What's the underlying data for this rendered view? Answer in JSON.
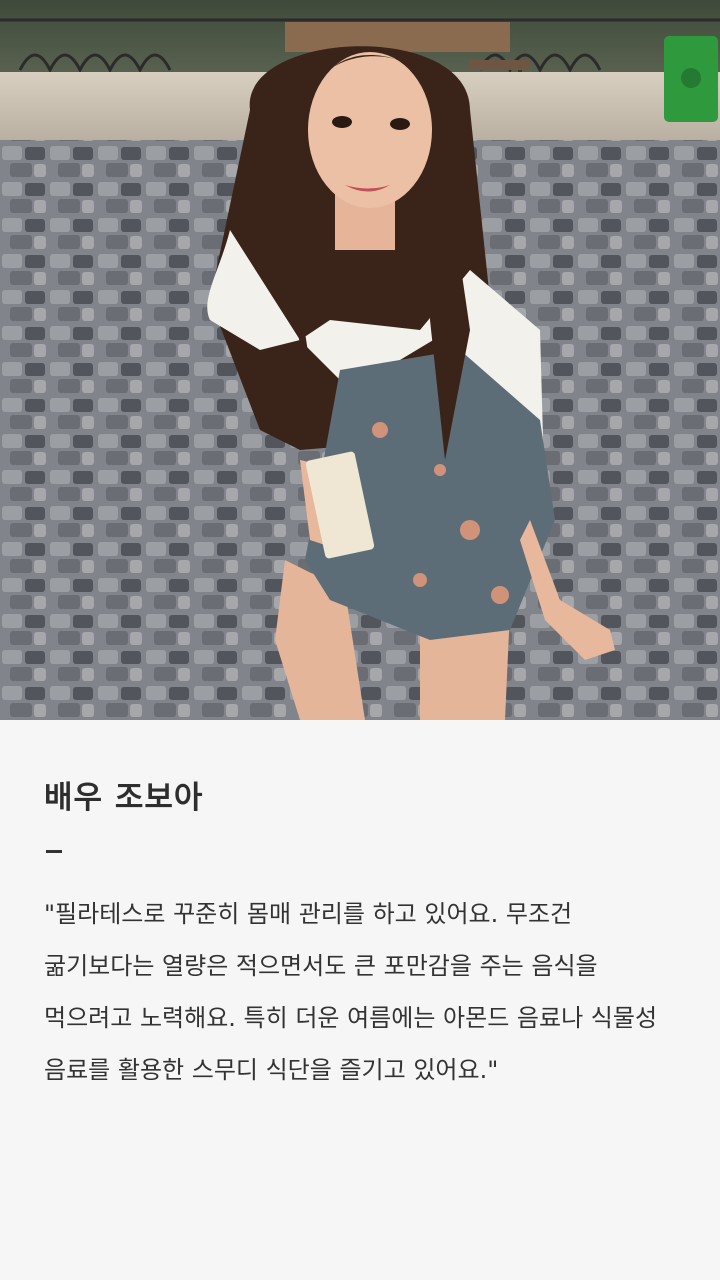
{
  "photo": {
    "description_icon": "portrait-photo",
    "colors": {
      "cobblestone_light": "#a3a6ab",
      "cobblestone_dark": "#45484e",
      "blouse": "#f3f1ec",
      "dress": "#5d6d78",
      "hair": "#3a241a",
      "skin": "#e8b89c"
    }
  },
  "article": {
    "name": "배우 조보아",
    "quote": "\"필라테스로 꾸준히 몸매 관리를 하고 있어요. 무조건 굶기보다는 열량은 적으면서도 큰 포만감을 주는 음식을 먹으려고 노력해요. 특히 더운 여름에는 아몬드 음료나 식물성 음료를 활용한 스무디 식단을 즐기고 있어요.\""
  }
}
